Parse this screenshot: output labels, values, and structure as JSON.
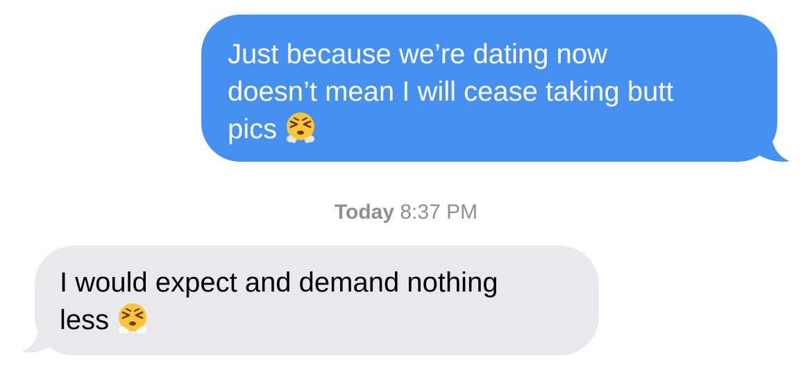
{
  "conversation": {
    "sent_message": {
      "lines": [
        "Just because we’re dating now",
        "doesn’t mean I will cease taking butt",
        "pics"
      ],
      "emoji": "face-with-steam-from-nose-icon",
      "color": "#4690f1"
    },
    "timestamp": {
      "day": "Today",
      "time": "8:37 PM"
    },
    "received_message": {
      "lines": [
        "I would expect and demand nothing",
        "less"
      ],
      "emoji": "face-with-steam-from-nose-icon",
      "color": "#e9e9eb"
    }
  }
}
